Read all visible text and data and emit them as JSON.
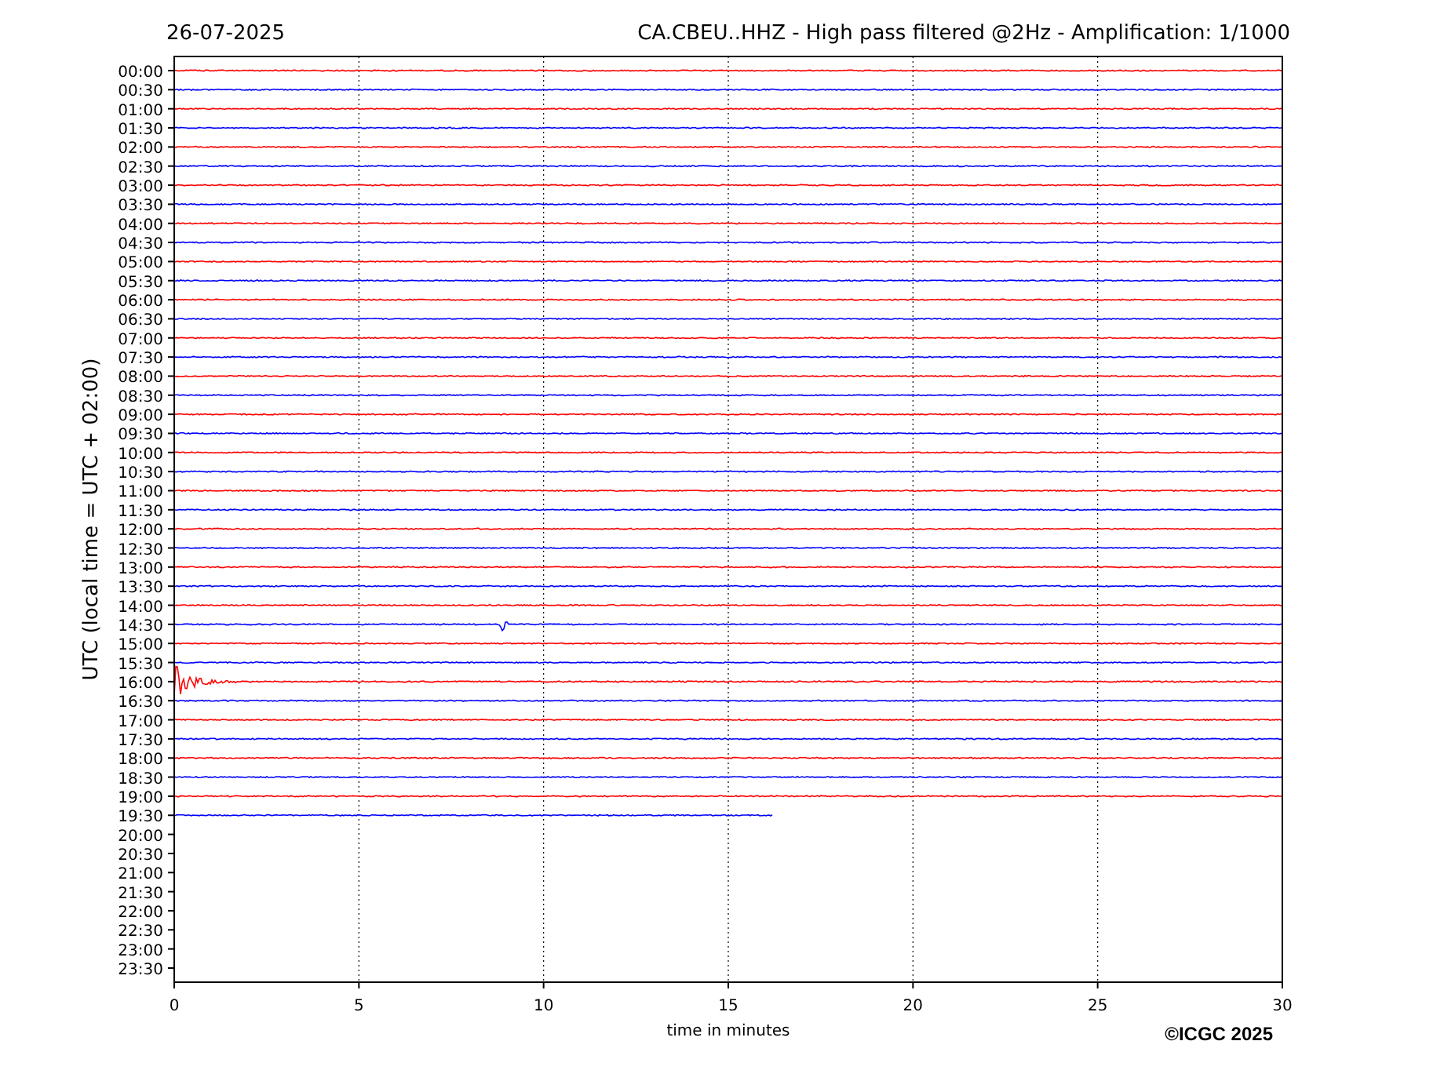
{
  "title_left": "26-07-2025",
  "title_right": "CA.CBEU..HHZ - High pass filtered @2Hz - Amplification: 1/1000",
  "ylabel": "UTC (local time = UTC + 02:00)",
  "xlabel": "time in minutes",
  "xticks": [
    "0",
    "5",
    "10",
    "15",
    "20",
    "25",
    "30"
  ],
  "credit": "©ICGC 2025",
  "rows": [
    {
      "label": "00:00",
      "trace": {
        "color": "#ff0000",
        "level": 1
      }
    },
    {
      "label": "00:30",
      "trace": {
        "color": "#0000ff",
        "level": 1
      }
    },
    {
      "label": "01:00",
      "trace": {
        "color": "#ff0000",
        "level": 1
      }
    },
    {
      "label": "01:30",
      "trace": {
        "color": "#0000ff",
        "level": 1
      }
    },
    {
      "label": "02:00",
      "trace": {
        "color": "#ff0000",
        "level": 1
      }
    },
    {
      "label": "02:30",
      "trace": {
        "color": "#0000ff",
        "level": 1
      }
    },
    {
      "label": "03:00",
      "trace": {
        "color": "#ff0000",
        "level": 1
      }
    },
    {
      "label": "03:30",
      "trace": {
        "color": "#0000ff",
        "level": 1
      }
    },
    {
      "label": "04:00",
      "trace": {
        "color": "#ff0000",
        "level": 1
      }
    },
    {
      "label": "04:30",
      "trace": {
        "color": "#0000ff",
        "level": 1
      }
    },
    {
      "label": "05:00",
      "trace": {
        "color": "#ff0000",
        "level": 1
      }
    },
    {
      "label": "05:30",
      "trace": {
        "color": "#0000ff",
        "level": 1
      }
    },
    {
      "label": "06:00",
      "trace": {
        "color": "#ff0000",
        "level": 1
      }
    },
    {
      "label": "06:30",
      "trace": {
        "color": "#0000ff",
        "level": 1
      }
    },
    {
      "label": "07:00",
      "trace": {
        "color": "#ff0000",
        "level": 1
      }
    },
    {
      "label": "07:30",
      "trace": {
        "color": "#0000ff",
        "level": 1
      }
    },
    {
      "label": "08:00",
      "trace": {
        "color": "#ff0000",
        "level": 1
      }
    },
    {
      "label": "08:30",
      "trace": {
        "color": "#0000ff",
        "level": 1
      }
    },
    {
      "label": "09:00",
      "trace": {
        "color": "#ff0000",
        "level": 1
      }
    },
    {
      "label": "09:30",
      "trace": {
        "color": "#0000ff",
        "level": 1
      }
    },
    {
      "label": "10:00",
      "trace": {
        "color": "#ff0000",
        "level": 1
      }
    },
    {
      "label": "10:30",
      "trace": {
        "color": "#0000ff",
        "level": 1
      }
    },
    {
      "label": "11:00",
      "trace": {
        "color": "#ff0000",
        "level": 1
      }
    },
    {
      "label": "11:30",
      "trace": {
        "color": "#0000ff",
        "level": 1
      }
    },
    {
      "label": "12:00",
      "trace": {
        "color": "#ff0000",
        "level": 1
      }
    },
    {
      "label": "12:30",
      "trace": {
        "color": "#0000ff",
        "level": 1
      }
    },
    {
      "label": "13:00",
      "trace": {
        "color": "#ff0000",
        "level": 1
      }
    },
    {
      "label": "13:30",
      "trace": {
        "color": "#0000ff",
        "level": 1
      }
    },
    {
      "label": "14:00",
      "trace": {
        "color": "#ff0000",
        "level": 1
      }
    },
    {
      "label": "14:30",
      "trace": {
        "color": "#0000ff",
        "level": 1
      }
    },
    {
      "label": "15:00",
      "trace": {
        "color": "#ff0000",
        "level": 1
      }
    },
    {
      "label": "15:30",
      "trace": {
        "color": "#0000ff",
        "level": 1
      }
    },
    {
      "label": "16:00",
      "trace": {
        "color": "#ff0000",
        "level": 1
      }
    },
    {
      "label": "16:30",
      "trace": {
        "color": "#0000ff",
        "level": 1
      }
    },
    {
      "label": "17:00",
      "trace": {
        "color": "#ff0000",
        "level": 1
      }
    },
    {
      "label": "17:30",
      "trace": {
        "color": "#0000ff",
        "level": 1
      }
    },
    {
      "label": "18:00",
      "trace": {
        "color": "#ff0000",
        "level": 1
      }
    },
    {
      "label": "18:30",
      "trace": {
        "color": "#0000ff",
        "level": 1
      }
    },
    {
      "label": "19:00",
      "trace": {
        "color": "#ff0000",
        "level": 1
      }
    },
    {
      "label": "19:30",
      "trace": {
        "color": "#0000ff",
        "level": 0.54
      }
    },
    {
      "label": "20:00"
    },
    {
      "label": "20:30"
    },
    {
      "label": "21:00"
    },
    {
      "label": "21:30"
    },
    {
      "label": "22:00"
    },
    {
      "label": "22:30"
    },
    {
      "label": "23:00"
    },
    {
      "label": "23:30"
    }
  ]
}
